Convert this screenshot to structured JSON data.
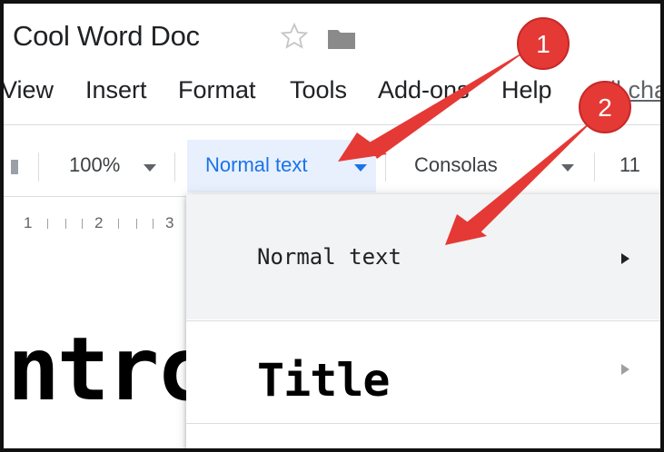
{
  "header": {
    "doc_title": "Cool Word Doc"
  },
  "menu": {
    "items": [
      "View",
      "Insert",
      "Format",
      "Tools",
      "Add-ons",
      "Help"
    ],
    "all_changes": "All cha"
  },
  "toolbar": {
    "zoom": "100%",
    "style": "Normal text",
    "font": "Consolas",
    "size": "11"
  },
  "ruler": {
    "labels": [
      "1",
      "2",
      "3"
    ]
  },
  "document": {
    "visible_text": "ntrc"
  },
  "dropdown": {
    "items": [
      {
        "label": "Normal text"
      },
      {
        "label": "Title"
      }
    ]
  },
  "annotations": {
    "badge_1": "1",
    "badge_2": "2",
    "color": "#e53935"
  },
  "colors": {
    "accent": "#1a73e8",
    "highlight_bg": "#e8f0fe",
    "hover_bg": "#f1f3f4"
  }
}
